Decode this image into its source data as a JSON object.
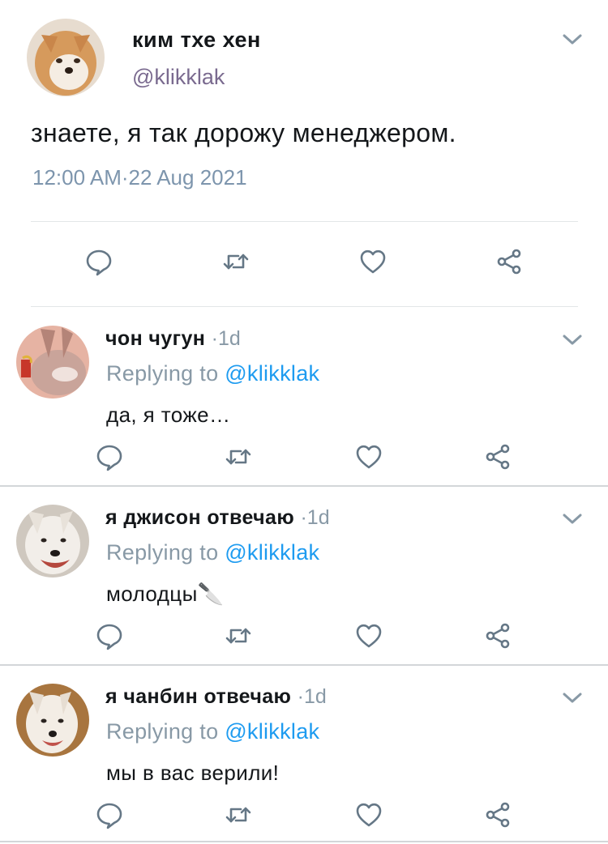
{
  "main": {
    "author_name": "ким тхе хен",
    "handle": "@klikklak",
    "text": "знаете, я так дорожу менеджером.",
    "timestamp": "12:00 AM·22 Aug 2021",
    "icons": {
      "menu": "chevron-down-icon",
      "reply": "reply-icon",
      "retweet": "retweet-icon",
      "like": "heart-icon",
      "share": "share-icon"
    }
  },
  "replies": [
    {
      "author_name": "чон чугун",
      "time": "·1d",
      "replying_prefix": "Replying to",
      "replying_handle": "@klikklak",
      "text": "да, я тоже…"
    },
    {
      "author_name": "я джисон отвечаю",
      "time": "·1d",
      "replying_prefix": "Replying to",
      "replying_handle": "@klikklak",
      "text": "молодцы🔪"
    },
    {
      "author_name": "я чанбин отвечаю",
      "time": "·1d",
      "replying_prefix": "Replying to",
      "replying_handle": "@klikklak",
      "text": "мы в вас верили!"
    }
  ],
  "colors": {
    "link": "#1d9bf0",
    "muted": "#8899a6",
    "timestamp": "#7d95ad",
    "handle": "#7a6a8f"
  }
}
